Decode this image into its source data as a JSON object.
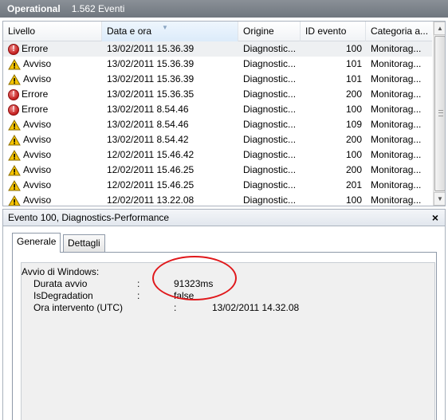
{
  "header": {
    "title": "Operational",
    "count": "1.562 Eventi"
  },
  "columns": [
    "Livello",
    "Data e ora",
    "Origine",
    "ID evento",
    "Categoria a..."
  ],
  "rows": [
    {
      "level": "Errore",
      "icon": "error-icon",
      "date": "13/02/2011 15.36.39",
      "source": "Diagnostic...",
      "id": "100",
      "category": "Monitorag..."
    },
    {
      "level": "Avviso",
      "icon": "warning-icon",
      "date": "13/02/2011 15.36.39",
      "source": "Diagnostic...",
      "id": "101",
      "category": "Monitorag..."
    },
    {
      "level": "Avviso",
      "icon": "warning-icon",
      "date": "13/02/2011 15.36.39",
      "source": "Diagnostic...",
      "id": "101",
      "category": "Monitorag..."
    },
    {
      "level": "Errore",
      "icon": "error-icon",
      "date": "13/02/2011 15.36.35",
      "source": "Diagnostic...",
      "id": "200",
      "category": "Monitorag..."
    },
    {
      "level": "Errore",
      "icon": "error-icon",
      "date": "13/02/2011 8.54.46",
      "source": "Diagnostic...",
      "id": "100",
      "category": "Monitorag..."
    },
    {
      "level": "Avviso",
      "icon": "warning-icon",
      "date": "13/02/2011 8.54.46",
      "source": "Diagnostic...",
      "id": "109",
      "category": "Monitorag..."
    },
    {
      "level": "Avviso",
      "icon": "warning-icon",
      "date": "13/02/2011 8.54.42",
      "source": "Diagnostic...",
      "id": "200",
      "category": "Monitorag..."
    },
    {
      "level": "Avviso",
      "icon": "warning-icon",
      "date": "12/02/2011 15.46.42",
      "source": "Diagnostic...",
      "id": "100",
      "category": "Monitorag..."
    },
    {
      "level": "Avviso",
      "icon": "warning-icon",
      "date": "12/02/2011 15.46.25",
      "source": "Diagnostic...",
      "id": "200",
      "category": "Monitorag..."
    },
    {
      "level": "Avviso",
      "icon": "warning-icon",
      "date": "12/02/2011 15.46.25",
      "source": "Diagnostic...",
      "id": "201",
      "category": "Monitorag..."
    },
    {
      "level": "Avviso",
      "icon": "warning-icon",
      "date": "12/02/2011 13.22.08",
      "source": "Diagnostic...",
      "id": "100",
      "category": "Monitorag..."
    }
  ],
  "detail": {
    "title": "Evento 100, Diagnostics-Performance",
    "close_glyph": "×",
    "tabs": [
      "Generale",
      "Dettagli"
    ],
    "section": "Avvio di Windows:",
    "fields": [
      {
        "key": "Durata avvio",
        "sep": ":",
        "value": "91323ms"
      },
      {
        "key": "IsDegradation",
        "sep": ":",
        "value": "false"
      },
      {
        "key": "Ora intervento (UTC)",
        "sep": ":",
        "value": "13/02/2011 14.32.08"
      }
    ]
  },
  "colors": {
    "error": "#c21d1d",
    "warning": "#f5c400",
    "annotation": "#e0181b"
  }
}
